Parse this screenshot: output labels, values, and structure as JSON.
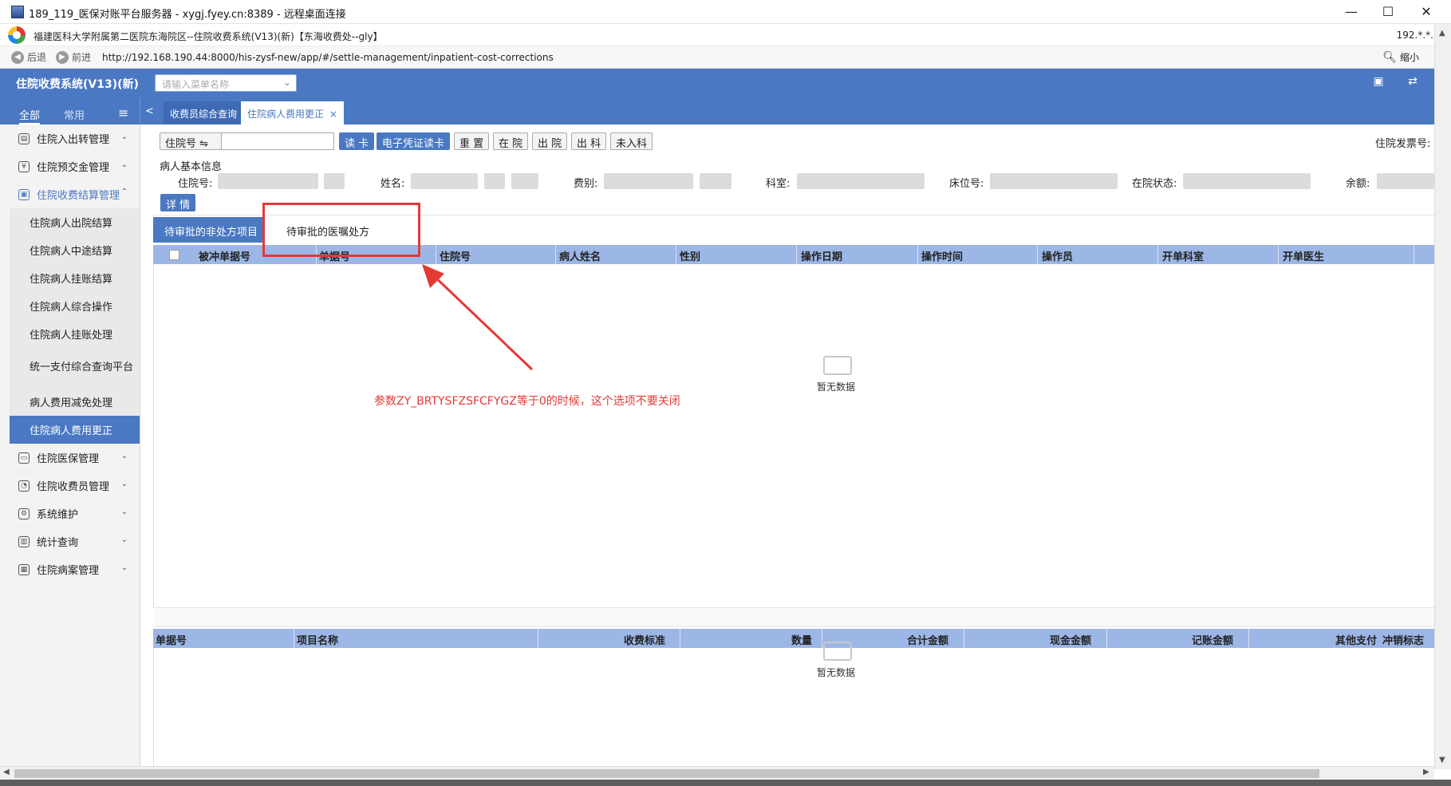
{
  "window": {
    "title": "189_119_医保对账平台服务器 - xygj.fyey.cn:8389 - 远程桌面连接",
    "minimize": "—",
    "maximize": "☐",
    "close": "✕"
  },
  "browser": {
    "page_title": "福建医科大学附属第二医院东海院区--住院收费系统(V13)(新)【东海收费处--gly】",
    "ip_short": "192.*.*.",
    "back_label": "后退",
    "forward_label": "前进",
    "url": "http://192.168.190.44:8000/his-zysf-new/app/#/settle-management/inpatient-cost-corrections",
    "zoom_label": "缩小"
  },
  "app": {
    "name": "住院收费系统(V13)(新)",
    "menu_search_placeholder": "请输入菜单名称"
  },
  "sidebar": {
    "tab_all": "全部",
    "tab_common": "常用",
    "menu_icon": "≡",
    "items": [
      {
        "label": "住院入出转管理",
        "icon": "▤"
      },
      {
        "label": "住院预交金管理",
        "icon": "¥"
      },
      {
        "label": "住院收费结算管理",
        "icon": "▣"
      },
      {
        "label": "住院医保管理",
        "icon": "▭"
      },
      {
        "label": "住院收费员管理",
        "icon": "◔"
      },
      {
        "label": "系统维护",
        "icon": "⚙"
      },
      {
        "label": "统计查询",
        "icon": "▥"
      },
      {
        "label": "住院病案管理",
        "icon": "▦"
      }
    ],
    "subitems": [
      "住院病人出院结算",
      "住院病人中途结算",
      "住院病人挂账结算",
      "住院病人综合操作",
      "住院病人挂账处理",
      "统一支付综合查询平台",
      "病人费用减免处理",
      "住院病人费用更正"
    ]
  },
  "tabs": {
    "collapse": "<",
    "items": [
      {
        "label": "收费员综合查询"
      },
      {
        "label": "住院病人费用更正",
        "close": "×"
      }
    ]
  },
  "toolbar": {
    "id_type": "住院号 ⇋",
    "buttons": [
      "读 卡",
      "电子凭证读卡",
      "重 置",
      "在 院",
      "出 院",
      "出 科",
      "未入科"
    ],
    "invoice_label": "住院发票号:"
  },
  "patient": {
    "section_title": "病人基本信息",
    "fields": [
      "住院号:",
      "姓名:",
      "费别:",
      "科室:",
      "床位号:",
      "在院状态:",
      "余额:"
    ],
    "detail_button": "详 情"
  },
  "subtabs": [
    "待审批的非处方项目",
    "待审批的医嘱处方"
  ],
  "grid1": {
    "columns": [
      "被冲单据号",
      "单据号",
      "住院号",
      "病人姓名",
      "性别",
      "操作日期",
      "操作时间",
      "操作员",
      "开单科室",
      "开单医生"
    ],
    "empty_text": "暂无数据"
  },
  "grid2": {
    "columns": [
      "单据号",
      "项目名称",
      "收费标准",
      "数量",
      "合计金额",
      "现金金额",
      "记账金额",
      "其他支付",
      "冲销标志"
    ],
    "empty_text": "暂无数据"
  },
  "annotation": {
    "text": "参数ZY_BRTYSFZSFCFYGZ等于0的时候，这个选项不要关闭",
    "color": "#e53935"
  },
  "colors": {
    "accent": "#4a78c2",
    "grid_header": "#9cb7e6"
  }
}
